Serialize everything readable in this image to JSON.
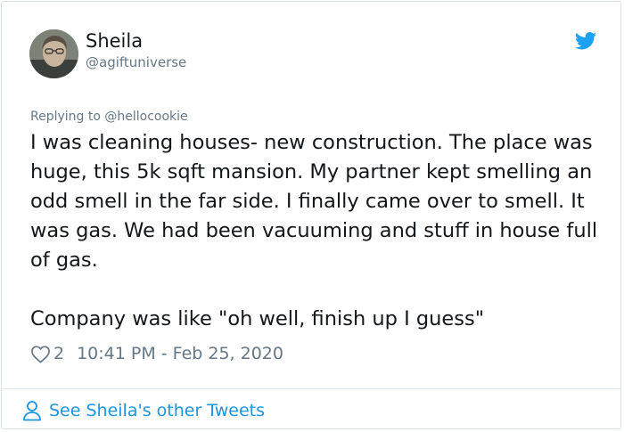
{
  "author": {
    "name": "Sheila",
    "handle": "@agiftuniverse"
  },
  "reply": {
    "prefix": "Replying to ",
    "handle": "@hellocookie"
  },
  "tweet": {
    "paragraphs": [
      "I was cleaning houses- new construction. The place was huge, this 5k sqft mansion. My partner kept smelling an odd smell in the far side. I finally came over to smell. It was gas. We had been vacuuming and stuff in house full of gas.",
      "Company was like \"oh well, finish up I guess\""
    ],
    "like_count": "2",
    "timestamp": "10:41 PM - Feb 25, 2020"
  },
  "footer": {
    "link_label": "See Sheila's other Tweets"
  },
  "icons": {
    "brand": "twitter-bird-icon",
    "like": "heart-outline-icon",
    "profile": "person-outline-icon"
  },
  "colors": {
    "brand_blue": "#1da1f2",
    "link_blue": "#1b95e0",
    "secondary_text": "#657786",
    "primary_text": "#14171a"
  }
}
